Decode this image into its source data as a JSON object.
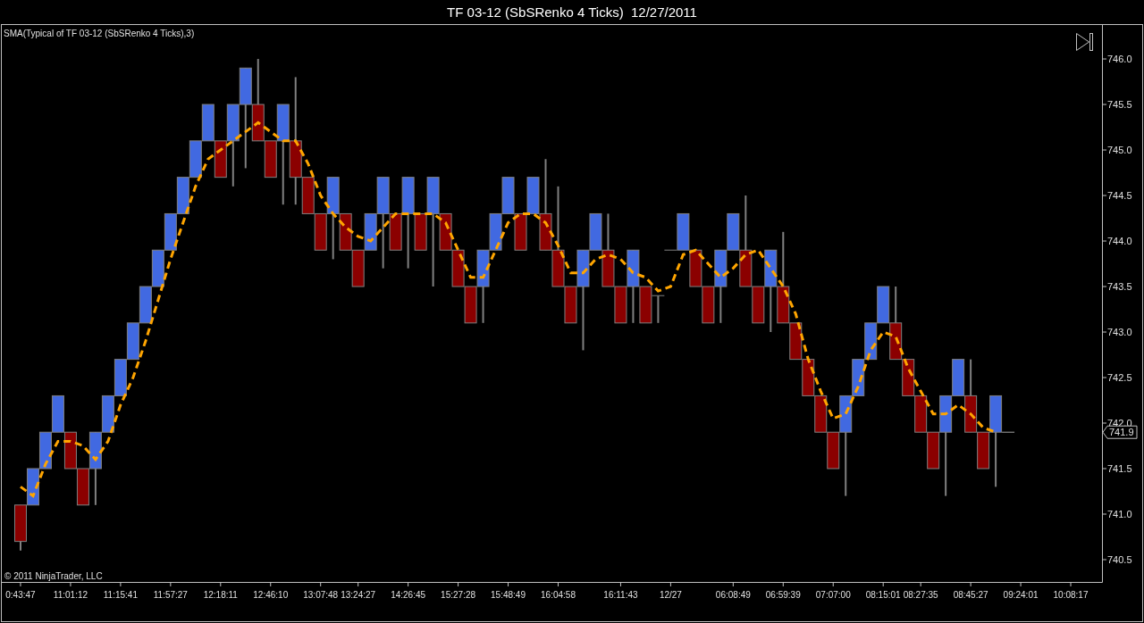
{
  "window": {
    "title": "TF 03-12 (SbSRenko 4 Ticks)  12/27/2011"
  },
  "chart": {
    "indicator_label": "SMA(Typical of TF 03-12 (SbSRenko 4 Ticks),3)",
    "copyright": "© 2011 NinjaTrader, LLC",
    "chart_data": {
      "type": "candlestick",
      "ylim": [
        740.255,
        746.373
      ],
      "categories": [
        null,
        "0:43:47",
        null,
        null,
        null,
        "11:01:12",
        null,
        null,
        null,
        "11:15:41",
        null,
        null,
        null,
        "11:57:27",
        null,
        null,
        null,
        "12:18:11",
        null,
        null,
        null,
        "12:46:10",
        null,
        null,
        null,
        "13:07:48",
        null,
        null,
        "13:24:27",
        null,
        null,
        null,
        "14:26:45",
        null,
        null,
        null,
        "15:27:28",
        null,
        null,
        null,
        "15:48:49",
        null,
        null,
        null,
        "16:04:58",
        null,
        null,
        null,
        null,
        "16:11:43",
        null,
        null,
        null,
        "12/27",
        null,
        null,
        null,
        null,
        "06:08:49",
        null,
        null,
        null,
        "06:59:39",
        null,
        null,
        null,
        "07:07:00",
        null,
        null,
        null,
        "08:15:01",
        null,
        null,
        "08:27:35",
        null,
        null,
        null,
        "08:45:27",
        null,
        null,
        null,
        "09:24:01",
        null,
        null,
        null,
        "10:08:17",
        null,
        null
      ],
      "yticks": [
        {
          "value": 740.5,
          "label": "740.5"
        },
        {
          "value": 741,
          "label": "741.0"
        },
        {
          "value": 741.5,
          "label": "741.5"
        },
        {
          "value": 742,
          "label": "742.0"
        },
        {
          "value": 742.5,
          "label": "742.5"
        },
        {
          "value": 743,
          "label": "743.0"
        },
        {
          "value": 743.5,
          "label": "743.5"
        },
        {
          "value": 744,
          "label": "744.0"
        },
        {
          "value": 744.5,
          "label": "744.5"
        },
        {
          "value": 745,
          "label": "745.0"
        },
        {
          "value": 745.5,
          "label": "745.5"
        },
        {
          "value": 746,
          "label": "746.0"
        }
      ],
      "ohlc": [
        null,
        [
          741.1,
          741.1,
          740.6,
          740.7
        ],
        [
          741.1,
          741.5,
          741.1,
          741.5
        ],
        [
          741.5,
          741.9,
          741.5,
          741.9
        ],
        [
          741.9,
          742.3,
          741.9,
          742.3
        ],
        [
          741.9,
          741.9,
          741.5,
          741.5
        ],
        [
          741.5,
          741.5,
          741.1,
          741.1
        ],
        [
          741.5,
          741.9,
          741.1,
          741.9
        ],
        [
          741.9,
          742.3,
          741.9,
          742.3
        ],
        [
          742.3,
          742.7,
          742.3,
          742.7
        ],
        [
          742.7,
          743.1,
          742.7,
          743.1
        ],
        [
          743.1,
          743.5,
          743.1,
          743.5
        ],
        [
          743.5,
          743.9,
          743.5,
          743.9
        ],
        [
          743.9,
          744.3,
          743.9,
          744.3
        ],
        [
          744.3,
          744.7,
          744.3,
          744.7
        ],
        [
          744.7,
          745.1,
          744.7,
          745.1
        ],
        [
          745.1,
          745.5,
          745.1,
          745.5
        ],
        [
          745.1,
          745.1,
          744.7,
          744.7
        ],
        [
          745.1,
          745.5,
          744.6,
          745.5
        ],
        [
          745.5,
          745.9,
          744.8,
          745.9
        ],
        [
          745.5,
          746.0,
          745.1,
          745.1
        ],
        [
          745.1,
          745.1,
          744.7,
          744.7
        ],
        [
          745.1,
          745.5,
          744.4,
          745.5
        ],
        [
          745.1,
          745.8,
          744.4,
          744.7
        ],
        [
          744.7,
          744.7,
          744.3,
          744.3
        ],
        [
          744.3,
          744.3,
          743.9,
          743.9
        ],
        [
          744.3,
          744.7,
          743.8,
          744.7
        ],
        [
          744.3,
          744.3,
          743.9,
          743.9
        ],
        [
          743.9,
          743.9,
          743.5,
          743.5
        ],
        [
          743.9,
          744.3,
          743.9,
          744.3
        ],
        [
          744.3,
          744.7,
          743.7,
          744.7
        ],
        [
          744.3,
          744.3,
          743.9,
          743.9
        ],
        [
          744.3,
          744.7,
          743.7,
          744.7
        ],
        [
          744.3,
          744.3,
          743.9,
          743.9
        ],
        [
          744.3,
          744.7,
          743.5,
          744.7
        ],
        [
          744.3,
          744.3,
          743.9,
          743.9
        ],
        [
          743.9,
          743.9,
          743.5,
          743.5
        ],
        [
          743.5,
          743.5,
          743.1,
          743.1
        ],
        [
          743.5,
          743.9,
          743.1,
          743.9
        ],
        [
          743.9,
          744.3,
          743.9,
          744.3
        ],
        [
          744.3,
          744.7,
          744.3,
          744.7
        ],
        [
          744.3,
          744.3,
          743.9,
          743.9
        ],
        [
          744.3,
          744.7,
          744.3,
          744.7
        ],
        [
          744.3,
          744.9,
          743.9,
          743.9
        ],
        [
          743.9,
          744.6,
          743.5,
          743.5
        ],
        [
          743.5,
          743.5,
          743.1,
          743.1
        ],
        [
          743.5,
          743.9,
          742.8,
          743.9
        ],
        [
          743.9,
          744.3,
          743.9,
          744.3
        ],
        [
          743.9,
          744.3,
          743.5,
          743.5
        ],
        [
          743.5,
          743.5,
          743.1,
          743.1
        ],
        [
          743.5,
          743.9,
          743.1,
          743.9
        ],
        [
          743.5,
          743.5,
          743.1,
          743.1
        ],
        [
          743.4,
          743.4,
          743.1,
          743.4
        ],
        [
          743.9,
          743.9,
          743.9,
          743.9
        ],
        [
          743.9,
          744.3,
          743.9,
          744.3
        ],
        [
          743.9,
          743.9,
          743.5,
          743.5
        ],
        [
          743.5,
          743.5,
          743.1,
          743.1
        ],
        [
          743.5,
          743.9,
          743.1,
          743.9
        ],
        [
          743.9,
          744.3,
          743.9,
          744.3
        ],
        [
          743.9,
          744.5,
          743.5,
          743.5
        ],
        [
          743.5,
          743.5,
          743.1,
          743.1
        ],
        [
          743.5,
          743.9,
          743.0,
          743.9
        ],
        [
          743.5,
          744.1,
          743.1,
          743.1
        ],
        [
          743.1,
          743.1,
          742.7,
          742.7
        ],
        [
          742.7,
          742.7,
          742.3,
          742.3
        ],
        [
          742.3,
          742.3,
          741.9,
          741.9
        ],
        [
          741.9,
          741.9,
          741.5,
          741.5
        ],
        [
          741.9,
          742.3,
          741.2,
          742.3
        ],
        [
          742.3,
          742.7,
          742.3,
          742.7
        ],
        [
          742.7,
          743.1,
          742.7,
          743.1
        ],
        [
          743.1,
          743.5,
          743.1,
          743.5
        ],
        [
          743.1,
          743.5,
          742.7,
          742.7
        ],
        [
          742.7,
          742.7,
          742.3,
          742.3
        ],
        [
          742.3,
          742.3,
          741.9,
          741.9
        ],
        [
          741.9,
          741.9,
          741.5,
          741.5
        ],
        [
          741.9,
          742.3,
          741.2,
          742.3
        ],
        [
          742.3,
          742.7,
          742.3,
          742.7
        ],
        [
          742.3,
          742.7,
          741.9,
          741.9
        ],
        [
          741.9,
          741.9,
          741.5,
          741.5
        ],
        [
          741.9,
          742.3,
          741.3,
          742.3
        ],
        null,
        null,
        null,
        null,
        null,
        null,
        null,
        null
      ],
      "series": [
        {
          "type": "line",
          "line_style": "dashed",
          "color": "#ffa500",
          "values": [
            null,
            741.3,
            741.2,
            741.55,
            741.8,
            741.8,
            741.75,
            741.6,
            741.8,
            742.2,
            742.5,
            742.9,
            743.35,
            743.8,
            744.2,
            744.6,
            744.9,
            745.0,
            745.1,
            745.2,
            745.3,
            745.2,
            745.1,
            745.1,
            744.85,
            744.5,
            744.3,
            744.15,
            744.05,
            744.0,
            744.15,
            744.3,
            744.3,
            744.3,
            744.3,
            744.2,
            743.9,
            743.6,
            743.6,
            743.9,
            744.2,
            744.3,
            744.3,
            744.2,
            743.95,
            743.65,
            743.65,
            743.8,
            743.85,
            743.8,
            743.65,
            743.6,
            743.45,
            743.5,
            743.85,
            743.9,
            743.75,
            743.6,
            743.7,
            743.85,
            743.9,
            743.7,
            743.5,
            743.2,
            742.7,
            742.35,
            742.05,
            742.1,
            742.4,
            742.8,
            743.0,
            742.95,
            742.6,
            742.35,
            742.1,
            742.1,
            742.2,
            742.1,
            741.95,
            741.9,
            null,
            null,
            null,
            null,
            null,
            null,
            null,
            null
          ]
        }
      ],
      "annotations": [
        {
          "text": "741.9",
          "y": 741.9
        }
      ]
    }
  }
}
